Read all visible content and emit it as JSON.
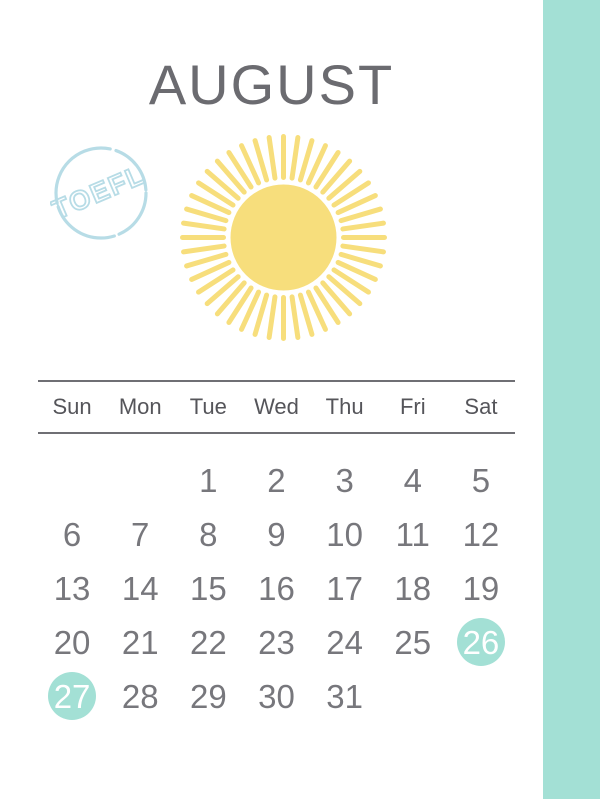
{
  "page": {
    "background_color": "#ffffff",
    "accent_band_color": "#a3e0d5",
    "title": "AUGUST",
    "title_color": "#6b6b70"
  },
  "stamp": {
    "text": "TOEFL",
    "color": "#b7dce6",
    "shape": "circle-stamp",
    "rotation_deg": -23
  },
  "sun": {
    "icon": "sun-icon",
    "color": "#f7de7c",
    "ray_count": 44
  },
  "calendar": {
    "rule_color": "#6f6f74",
    "weekday_color": "#55555a",
    "date_color": "#77777c",
    "highlight_color": "#a3e0d5",
    "highlight_text_color": "#ffffff",
    "weekdays": [
      "Sun",
      "Mon",
      "Tue",
      "Wed",
      "Thu",
      "Fri",
      "Sat"
    ],
    "leading_blanks": 2,
    "cells": [
      {
        "label": "",
        "empty": true,
        "highlight": false
      },
      {
        "label": "",
        "empty": true,
        "highlight": false
      },
      {
        "label": "1",
        "empty": false,
        "highlight": false
      },
      {
        "label": "2",
        "empty": false,
        "highlight": false
      },
      {
        "label": "3",
        "empty": false,
        "highlight": false
      },
      {
        "label": "4",
        "empty": false,
        "highlight": false
      },
      {
        "label": "5",
        "empty": false,
        "highlight": false
      },
      {
        "label": "6",
        "empty": false,
        "highlight": false
      },
      {
        "label": "7",
        "empty": false,
        "highlight": false
      },
      {
        "label": "8",
        "empty": false,
        "highlight": false
      },
      {
        "label": "9",
        "empty": false,
        "highlight": false
      },
      {
        "label": "10",
        "empty": false,
        "highlight": false
      },
      {
        "label": "11",
        "empty": false,
        "highlight": false
      },
      {
        "label": "12",
        "empty": false,
        "highlight": false
      },
      {
        "label": "13",
        "empty": false,
        "highlight": false
      },
      {
        "label": "14",
        "empty": false,
        "highlight": false
      },
      {
        "label": "15",
        "empty": false,
        "highlight": false
      },
      {
        "label": "16",
        "empty": false,
        "highlight": false
      },
      {
        "label": "17",
        "empty": false,
        "highlight": false
      },
      {
        "label": "18",
        "empty": false,
        "highlight": false
      },
      {
        "label": "19",
        "empty": false,
        "highlight": false
      },
      {
        "label": "20",
        "empty": false,
        "highlight": false
      },
      {
        "label": "21",
        "empty": false,
        "highlight": false
      },
      {
        "label": "22",
        "empty": false,
        "highlight": false
      },
      {
        "label": "23",
        "empty": false,
        "highlight": false
      },
      {
        "label": "24",
        "empty": false,
        "highlight": false
      },
      {
        "label": "25",
        "empty": false,
        "highlight": false
      },
      {
        "label": "26",
        "empty": false,
        "highlight": true
      },
      {
        "label": "27",
        "empty": false,
        "highlight": true
      },
      {
        "label": "28",
        "empty": false,
        "highlight": false
      },
      {
        "label": "29",
        "empty": false,
        "highlight": false
      },
      {
        "label": "30",
        "empty": false,
        "highlight": false
      },
      {
        "label": "31",
        "empty": false,
        "highlight": false
      },
      {
        "label": "",
        "empty": true,
        "highlight": false
      },
      {
        "label": "",
        "empty": true,
        "highlight": false
      }
    ]
  }
}
